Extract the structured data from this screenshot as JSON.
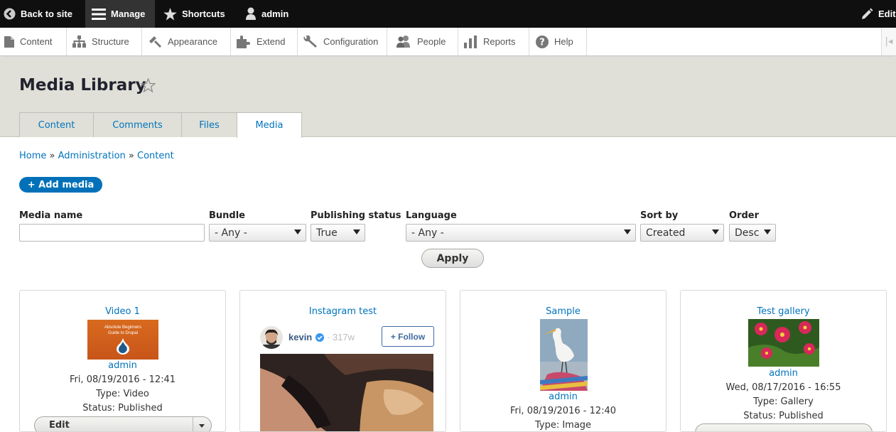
{
  "toolbar": {
    "back_label": "Back to site",
    "manage_label": "Manage",
    "shortcuts_label": "Shortcuts",
    "user_label": "admin",
    "edit_label": "Edit"
  },
  "tray": {
    "items": [
      "Content",
      "Structure",
      "Appearance",
      "Extend",
      "Configuration",
      "People",
      "Reports",
      "Help"
    ]
  },
  "page": {
    "title": "Media Library",
    "tabs": [
      "Content",
      "Comments",
      "Files",
      "Media"
    ],
    "active_tab": "Media"
  },
  "breadcrumb": {
    "home": "Home",
    "sep": "»",
    "admin": "Administration",
    "content": "Content"
  },
  "actions": {
    "add_media": "+ Add media"
  },
  "filters": {
    "media_name": {
      "label": "Media name",
      "value": ""
    },
    "bundle": {
      "label": "Bundle",
      "value": "- Any -"
    },
    "publishing_status": {
      "label": "Publishing status",
      "value": "True"
    },
    "language": {
      "label": "Language",
      "value": "- Any -"
    },
    "sort_by": {
      "label": "Sort by",
      "value": "Created"
    },
    "order": {
      "label": "Order",
      "value": "Desc"
    },
    "apply_label": "Apply"
  },
  "cards": [
    {
      "title": "Video 1",
      "thumb_text": [
        "Absolute Beginners",
        "Guide to Drupal"
      ],
      "author": "admin",
      "date": "Fri, 08/19/2016 - 12:41",
      "type": "Type: Video",
      "status": "Status: Published",
      "button": "Edit"
    },
    {
      "title": "Instagram test",
      "insta_user": "kevin",
      "insta_ago": "· 317w",
      "follow_label": "+ Follow"
    },
    {
      "title": "Sample",
      "author": "admin",
      "date": "Fri, 08/19/2016 - 12:40",
      "type": "Type: Image"
    },
    {
      "title": "Test gallery",
      "author": "admin",
      "date": "Wed, 08/17/2016 - 16:55",
      "type": "Type: Gallery",
      "status": "Status: Published"
    }
  ],
  "colors": {
    "link": "#0074bd",
    "primary_button": "#0071b8",
    "toolbar": "#0f0f0f",
    "header_bg": "#e0e0d8"
  }
}
